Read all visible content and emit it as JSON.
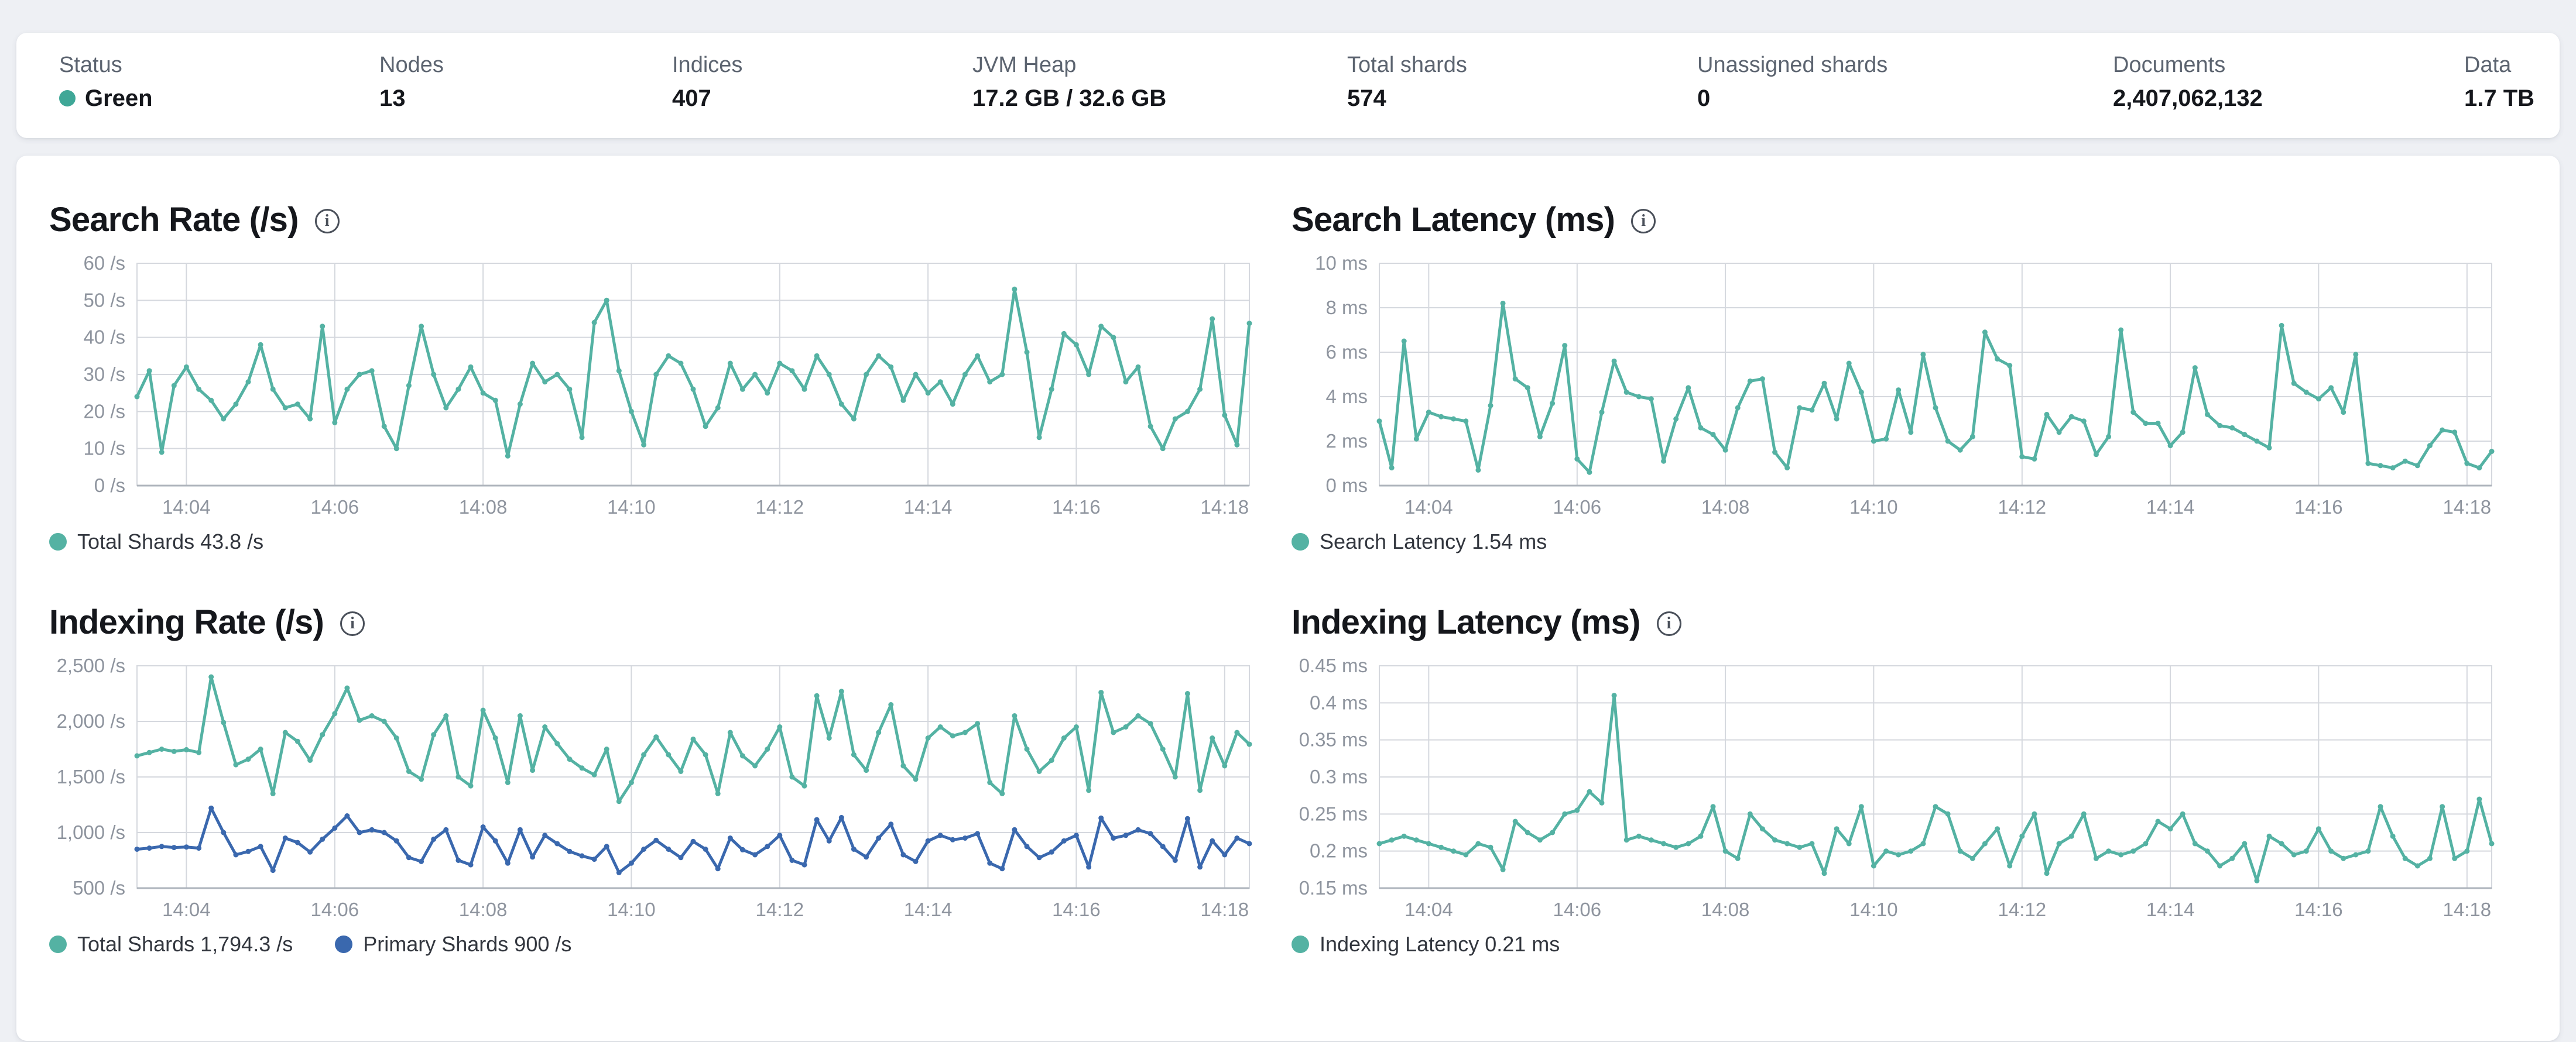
{
  "colors": {
    "teal": "#54b2a3",
    "blue": "#3a68ae",
    "status_green_dot": "#3fa797",
    "grid": "#d5d8de",
    "axis": "#aeb4bc",
    "tick_text": "#8e949e",
    "title_text": "#15171c",
    "card_bg": "#ffffff",
    "page_bg": "#eef0f4"
  },
  "status_bar": {
    "stats": [
      {
        "label": "Status",
        "value": "Green"
      },
      {
        "label": "Nodes",
        "value": "13"
      },
      {
        "label": "Indices",
        "value": "407"
      },
      {
        "label": "JVM Heap",
        "value": "17.2 GB / 32.6 GB"
      },
      {
        "label": "Total shards",
        "value": "574"
      },
      {
        "label": "Unassigned shards",
        "value": "0"
      },
      {
        "label": "Documents",
        "value": "2,407,062,132"
      },
      {
        "label": "Data",
        "value": "1.7 TB"
      }
    ]
  },
  "chart_data": [
    {
      "type": "line",
      "name": "search-rate",
      "title": "Search Rate (/s)",
      "xlabel": "",
      "ylabel": "/s",
      "ylim": [
        0,
        60
      ],
      "grid": true,
      "legend_position": "bottom-left",
      "y_ticks": [
        {
          "v": 60,
          "label": "60 /s"
        },
        {
          "v": 50,
          "label": "50 /s"
        },
        {
          "v": 40,
          "label": "40 /s"
        },
        {
          "v": 30,
          "label": "30 /s"
        },
        {
          "v": 20,
          "label": "20 /s"
        },
        {
          "v": 10,
          "label": "10 /s"
        },
        {
          "v": 0,
          "label": "0 /s"
        }
      ],
      "x_ticks": [
        {
          "f": 0.0444,
          "label": "14:04"
        },
        {
          "f": 0.1778,
          "label": "14:06"
        },
        {
          "f": 0.3111,
          "label": "14:08"
        },
        {
          "f": 0.4444,
          "label": "14:10"
        },
        {
          "f": 0.5778,
          "label": "14:12"
        },
        {
          "f": 0.7111,
          "label": "14:14"
        },
        {
          "f": 0.8444,
          "label": "14:16"
        },
        {
          "f": 0.9778,
          "label": "14:18"
        }
      ],
      "legend": [
        {
          "label": "Total Shards 43.8 /s",
          "color": "#54b2a3"
        }
      ],
      "series": [
        {
          "name": "Total Shards",
          "color": "#54b2a3",
          "values": [
            24,
            31,
            9,
            27,
            32,
            26,
            23,
            18,
            22,
            28,
            38,
            26,
            21,
            22,
            18,
            43,
            17,
            26,
            30,
            31,
            16,
            10,
            27,
            43,
            30,
            21,
            26,
            32,
            25,
            23,
            8,
            22,
            33,
            28,
            30,
            26,
            13,
            44,
            50,
            31,
            20,
            11,
            30,
            35,
            33,
            26,
            16,
            21,
            33,
            26,
            30,
            25,
            33,
            31,
            26,
            35,
            30,
            22,
            18,
            30,
            35,
            32,
            23,
            30,
            25,
            28,
            22,
            30,
            35,
            28,
            30,
            53,
            36,
            13,
            26,
            41,
            38,
            30,
            43,
            40,
            28,
            32,
            16,
            10,
            18,
            20,
            26,
            45,
            19,
            11,
            43.8
          ]
        }
      ]
    },
    {
      "type": "line",
      "name": "search-latency",
      "title": "Search Latency (ms)",
      "xlabel": "",
      "ylabel": "ms",
      "ylim": [
        0,
        10
      ],
      "grid": true,
      "legend_position": "bottom-left",
      "y_ticks": [
        {
          "v": 10,
          "label": "10 ms"
        },
        {
          "v": 8,
          "label": "8 ms"
        },
        {
          "v": 6,
          "label": "6 ms"
        },
        {
          "v": 4,
          "label": "4 ms"
        },
        {
          "v": 2,
          "label": "2 ms"
        },
        {
          "v": 0,
          "label": "0 ms"
        }
      ],
      "x_ticks": [
        {
          "f": 0.0444,
          "label": "14:04"
        },
        {
          "f": 0.1778,
          "label": "14:06"
        },
        {
          "f": 0.3111,
          "label": "14:08"
        },
        {
          "f": 0.4444,
          "label": "14:10"
        },
        {
          "f": 0.5778,
          "label": "14:12"
        },
        {
          "f": 0.7111,
          "label": "14:14"
        },
        {
          "f": 0.8444,
          "label": "14:16"
        },
        {
          "f": 0.9778,
          "label": "14:18"
        }
      ],
      "legend": [
        {
          "label": "Search Latency 1.54 ms",
          "color": "#54b2a3"
        }
      ],
      "series": [
        {
          "name": "Search Latency",
          "color": "#54b2a3",
          "values": [
            2.9,
            0.8,
            6.5,
            2.1,
            3.3,
            3.1,
            3.0,
            2.9,
            0.7,
            3.6,
            8.2,
            4.8,
            4.4,
            2.2,
            3.7,
            6.3,
            1.2,
            0.6,
            3.3,
            5.6,
            4.2,
            4.0,
            3.9,
            1.1,
            3.0,
            4.4,
            2.6,
            2.3,
            1.6,
            3.5,
            4.7,
            4.8,
            1.5,
            0.8,
            3.5,
            3.4,
            4.6,
            3.0,
            5.5,
            4.2,
            2.0,
            2.1,
            4.3,
            2.4,
            5.9,
            3.5,
            2.0,
            1.6,
            2.2,
            6.9,
            5.7,
            5.4,
            1.3,
            1.2,
            3.2,
            2.4,
            3.1,
            2.9,
            1.4,
            2.2,
            7.0,
            3.3,
            2.8,
            2.8,
            1.8,
            2.4,
            5.3,
            3.2,
            2.7,
            2.6,
            2.3,
            2.0,
            1.7,
            7.2,
            4.6,
            4.2,
            3.9,
            4.4,
            3.3,
            5.9,
            1.0,
            0.9,
            0.8,
            1.1,
            0.9,
            1.8,
            2.5,
            2.4,
            1.0,
            0.8,
            1.54
          ]
        }
      ]
    },
    {
      "type": "line",
      "name": "indexing-rate",
      "title": "Indexing Rate (/s)",
      "xlabel": "",
      "ylabel": "/s",
      "ylim": [
        500,
        2500
      ],
      "grid": true,
      "legend_position": "bottom-left",
      "y_ticks": [
        {
          "v": 2500,
          "label": "2,500 /s"
        },
        {
          "v": 2000,
          "label": "2,000 /s"
        },
        {
          "v": 1500,
          "label": "1,500 /s"
        },
        {
          "v": 1000,
          "label": "1,000 /s"
        },
        {
          "v": 500,
          "label": "500 /s"
        }
      ],
      "x_ticks": [
        {
          "f": 0.0444,
          "label": "14:04"
        },
        {
          "f": 0.1778,
          "label": "14:06"
        },
        {
          "f": 0.3111,
          "label": "14:08"
        },
        {
          "f": 0.4444,
          "label": "14:10"
        },
        {
          "f": 0.5778,
          "label": "14:12"
        },
        {
          "f": 0.7111,
          "label": "14:14"
        },
        {
          "f": 0.8444,
          "label": "14:16"
        },
        {
          "f": 0.9778,
          "label": "14:18"
        }
      ],
      "legend": [
        {
          "label": "Total Shards 1,794.3 /s",
          "color": "#54b2a3"
        },
        {
          "label": "Primary Shards 900 /s",
          "color": "#3a68ae"
        }
      ],
      "series": [
        {
          "name": "Total Shards",
          "color": "#54b2a3",
          "values": [
            1690,
            1720,
            1750,
            1730,
            1745,
            1720,
            2400,
            1990,
            1610,
            1660,
            1750,
            1350,
            1900,
            1820,
            1650,
            1880,
            2070,
            2300,
            2010,
            2050,
            2000,
            1850,
            1550,
            1480,
            1880,
            2050,
            1500,
            1420,
            2100,
            1850,
            1450,
            2050,
            1560,
            1950,
            1800,
            1660,
            1580,
            1520,
            1750,
            1280,
            1450,
            1700,
            1860,
            1700,
            1550,
            1840,
            1700,
            1350,
            1900,
            1690,
            1600,
            1750,
            1950,
            1500,
            1420,
            2230,
            1850,
            2270,
            1700,
            1560,
            1900,
            2150,
            1600,
            1480,
            1850,
            1950,
            1870,
            1900,
            1980,
            1450,
            1350,
            2050,
            1750,
            1550,
            1650,
            1850,
            1950,
            1380,
            2260,
            1900,
            1950,
            2050,
            1980,
            1750,
            1500,
            2250,
            1380,
            1850,
            1600,
            1900,
            1794.3
          ]
        },
        {
          "name": "Primary Shards",
          "color": "#3a68ae",
          "values": [
            850,
            860,
            875,
            865,
            870,
            860,
            1220,
            1000,
            800,
            830,
            875,
            660,
            950,
            910,
            825,
            940,
            1040,
            1150,
            1000,
            1025,
            1000,
            925,
            775,
            740,
            940,
            1025,
            750,
            710,
            1050,
            925,
            725,
            1025,
            780,
            975,
            900,
            830,
            790,
            760,
            875,
            640,
            725,
            850,
            930,
            850,
            775,
            920,
            850,
            675,
            950,
            845,
            800,
            875,
            975,
            750,
            710,
            1115,
            925,
            1135,
            850,
            780,
            950,
            1075,
            800,
            740,
            925,
            975,
            935,
            950,
            990,
            725,
            675,
            1025,
            875,
            775,
            825,
            925,
            975,
            690,
            1130,
            950,
            975,
            1025,
            990,
            875,
            750,
            1125,
            690,
            925,
            800,
            950,
            900
          ]
        }
      ]
    },
    {
      "type": "line",
      "name": "indexing-latency",
      "title": "Indexing Latency (ms)",
      "xlabel": "",
      "ylabel": "ms",
      "ylim": [
        0.15,
        0.45
      ],
      "grid": true,
      "legend_position": "bottom-left",
      "y_ticks": [
        {
          "v": 0.45,
          "label": "0.45 ms"
        },
        {
          "v": 0.4,
          "label": "0.4 ms"
        },
        {
          "v": 0.35,
          "label": "0.35 ms"
        },
        {
          "v": 0.3,
          "label": "0.3 ms"
        },
        {
          "v": 0.25,
          "label": "0.25 ms"
        },
        {
          "v": 0.2,
          "label": "0.2 ms"
        },
        {
          "v": 0.15,
          "label": "0.15 ms"
        }
      ],
      "x_ticks": [
        {
          "f": 0.0444,
          "label": "14:04"
        },
        {
          "f": 0.1778,
          "label": "14:06"
        },
        {
          "f": 0.3111,
          "label": "14:08"
        },
        {
          "f": 0.4444,
          "label": "14:10"
        },
        {
          "f": 0.5778,
          "label": "14:12"
        },
        {
          "f": 0.7111,
          "label": "14:14"
        },
        {
          "f": 0.8444,
          "label": "14:16"
        },
        {
          "f": 0.9778,
          "label": "14:18"
        }
      ],
      "legend": [
        {
          "label": "Indexing Latency 0.21 ms",
          "color": "#54b2a3"
        }
      ],
      "series": [
        {
          "name": "Indexing Latency",
          "color": "#54b2a3",
          "values": [
            0.21,
            0.215,
            0.22,
            0.215,
            0.21,
            0.205,
            0.2,
            0.195,
            0.21,
            0.205,
            0.175,
            0.24,
            0.225,
            0.215,
            0.225,
            0.25,
            0.255,
            0.28,
            0.265,
            0.41,
            0.215,
            0.22,
            0.215,
            0.21,
            0.205,
            0.21,
            0.22,
            0.26,
            0.2,
            0.19,
            0.25,
            0.23,
            0.215,
            0.21,
            0.205,
            0.21,
            0.17,
            0.23,
            0.21,
            0.26,
            0.18,
            0.2,
            0.195,
            0.2,
            0.21,
            0.26,
            0.25,
            0.2,
            0.19,
            0.21,
            0.23,
            0.18,
            0.22,
            0.25,
            0.17,
            0.21,
            0.22,
            0.25,
            0.19,
            0.2,
            0.195,
            0.2,
            0.21,
            0.24,
            0.23,
            0.25,
            0.21,
            0.2,
            0.18,
            0.19,
            0.21,
            0.16,
            0.22,
            0.21,
            0.195,
            0.2,
            0.23,
            0.2,
            0.19,
            0.195,
            0.2,
            0.26,
            0.22,
            0.19,
            0.18,
            0.19,
            0.26,
            0.19,
            0.2,
            0.27,
            0.21
          ]
        }
      ]
    }
  ]
}
